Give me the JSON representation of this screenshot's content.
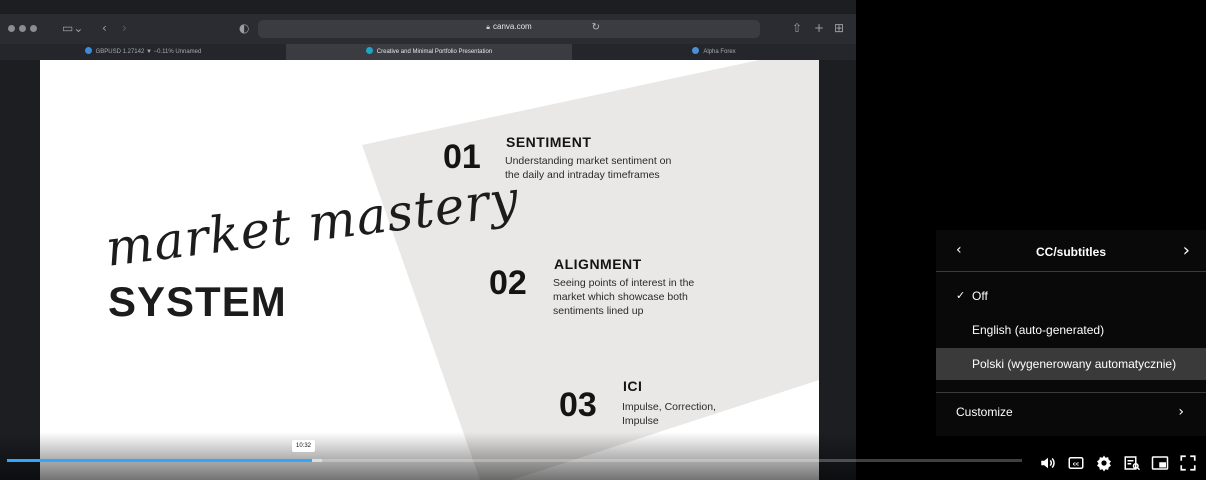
{
  "browser": {
    "url": "canva.com",
    "tabs": [
      {
        "label": "GBPUSD 1.27142 ▼ −0.11% Unnamed",
        "active": false,
        "favicon_color": "#3d8bd8"
      },
      {
        "label": "Creative and Minimal Portfolio Presentation",
        "active": true,
        "favicon_color": "#1ba6c9"
      },
      {
        "label": "Alpha Forex",
        "active": false,
        "favicon_color": "#4a90d9"
      }
    ]
  },
  "slide": {
    "script_title": "market mastery",
    "title": "SYSTEM",
    "steps": [
      {
        "number": "01",
        "heading": "SENTIMENT",
        "description": "Understanding market sentiment on the daily and intraday timeframes"
      },
      {
        "number": "02",
        "heading": "ALIGNMENT",
        "description": "Seeing points of interest in the market which showcase both sentiments lined up"
      },
      {
        "number": "03",
        "heading": "ICI",
        "description": "Impulse, Correction, Impulse"
      }
    ]
  },
  "player": {
    "hover_time": "10:32",
    "progress_played": 0.3,
    "progress_loaded": 0.31,
    "accent_color": "#2fa6ff",
    "controls": [
      "volume-icon",
      "subtitles-icon",
      "settings-icon",
      "miniplayer-icon",
      "pip-icon",
      "fullscreen-icon"
    ]
  },
  "cc_menu": {
    "title": "CC/subtitles",
    "back": "‹",
    "next": "›",
    "options": [
      {
        "label": "Off",
        "selected": true,
        "highlighted": false
      },
      {
        "label": "English (auto-generated)",
        "selected": false,
        "highlighted": false
      },
      {
        "label": "Polski (wygenerowany automatycznie)",
        "selected": false,
        "highlighted": true
      }
    ],
    "customize_label": "Customize",
    "customize_arrow": "›",
    "check_mark": "✓"
  }
}
